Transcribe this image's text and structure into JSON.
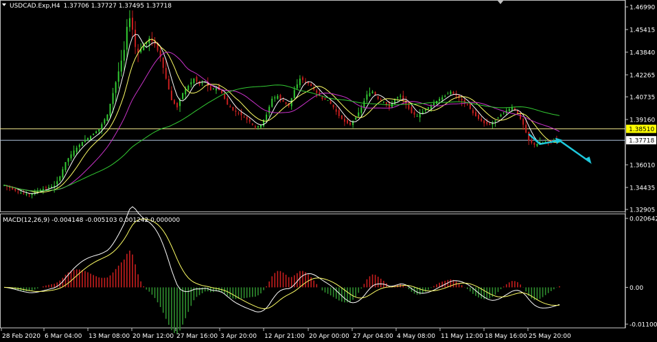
{
  "chart_data": [
    {
      "type": "candlestick",
      "symbol_label": "USDCAD.Exp,H4",
      "ohlc_label": "1.37706 1.37727 1.37495 1.37718",
      "ylim": [
        1.32905,
        1.4699
      ],
      "y_ticks": [
        "1.46990",
        "1.45415",
        "1.43840",
        "1.42265",
        "1.40735",
        "1.39160",
        "1.36010",
        "1.34435",
        "1.32905"
      ],
      "levels": [
        {
          "name": "resistance",
          "value": 1.3851,
          "label": "1.38510",
          "color": "#f0e68c",
          "tag_bg": "#ffff00",
          "tag_fg": "#000000"
        },
        {
          "name": "bid",
          "value": 1.37718,
          "label": "1.37718",
          "color": "#b0c4de",
          "tag_bg": "#ffffff",
          "tag_fg": "#000000"
        }
      ],
      "x_labels": [
        "28 Feb 2020",
        "6 Mar 04:00",
        "13 Mar 08:00",
        "20 Mar 12:00",
        "27 Mar 16:00",
        "3 Apr 20:00",
        "12 Apr 21:00",
        "20 Apr 00:00",
        "27 Apr 04:00",
        "4 May 08:00",
        "11 May 12:00",
        "18 May 16:00",
        "25 May 20:00"
      ],
      "close_path": [
        [
          0,
          1.346
        ],
        [
          3,
          1.343
        ],
        [
          6,
          1.3405
        ],
        [
          9,
          1.3395
        ],
        [
          12,
          1.342
        ],
        [
          15,
          1.344
        ],
        [
          18,
          1.3455
        ],
        [
          20,
          1.352
        ],
        [
          22,
          1.362
        ],
        [
          25,
          1.37
        ],
        [
          28,
          1.376
        ],
        [
          31,
          1.38
        ],
        [
          34,
          1.385
        ],
        [
          37,
          1.395
        ],
        [
          39,
          1.41
        ],
        [
          41,
          1.425
        ],
        [
          43,
          1.44
        ],
        [
          44,
          1.456
        ],
        [
          45,
          1.462
        ],
        [
          46,
          1.454
        ],
        [
          47,
          1.442
        ],
        [
          48,
          1.438
        ],
        [
          50,
          1.443
        ],
        [
          52,
          1.448
        ],
        [
          54,
          1.444
        ],
        [
          56,
          1.435
        ],
        [
          58,
          1.42
        ],
        [
          60,
          1.405
        ],
        [
          62,
          1.4
        ],
        [
          64,
          1.41
        ],
        [
          66,
          1.415
        ],
        [
          68,
          1.42
        ],
        [
          70,
          1.416
        ],
        [
          72,
          1.418
        ],
        [
          74,
          1.412
        ],
        [
          76,
          1.414
        ],
        [
          78,
          1.41
        ],
        [
          80,
          1.402
        ],
        [
          82,
          1.398
        ],
        [
          84,
          1.396
        ],
        [
          86,
          1.393
        ],
        [
          88,
          1.39
        ],
        [
          90,
          1.386
        ],
        [
          92,
          1.388
        ],
        [
          94,
          1.395
        ],
        [
          96,
          1.406
        ],
        [
          98,
          1.408
        ],
        [
          100,
          1.404
        ],
        [
          102,
          1.401
        ],
        [
          104,
          1.412
        ],
        [
          106,
          1.42
        ],
        [
          108,
          1.418
        ],
        [
          110,
          1.415
        ],
        [
          112,
          1.41
        ],
        [
          114,
          1.406
        ],
        [
          116,
          1.405
        ],
        [
          118,
          1.4
        ],
        [
          120,
          1.394
        ],
        [
          122,
          1.39
        ],
        [
          124,
          1.388
        ],
        [
          126,
          1.393
        ],
        [
          128,
          1.4
        ],
        [
          130,
          1.409
        ],
        [
          132,
          1.411
        ],
        [
          134,
          1.406
        ],
        [
          136,
          1.404
        ],
        [
          138,
          1.4
        ],
        [
          140,
          1.406
        ],
        [
          142,
          1.408
        ],
        [
          144,
          1.402
        ],
        [
          146,
          1.396
        ],
        [
          148,
          1.394
        ],
        [
          150,
          1.397
        ],
        [
          152,
          1.4
        ],
        [
          154,
          1.403
        ],
        [
          156,
          1.406
        ],
        [
          158,
          1.408
        ],
        [
          160,
          1.411
        ],
        [
          162,
          1.408
        ],
        [
          164,
          1.405
        ],
        [
          166,
          1.402
        ],
        [
          168,
          1.396
        ],
        [
          170,
          1.392
        ],
        [
          172,
          1.389
        ],
        [
          174,
          1.388
        ],
        [
          176,
          1.391
        ],
        [
          178,
          1.395
        ],
        [
          180,
          1.398
        ],
        [
          182,
          1.4
        ],
        [
          184,
          1.396
        ],
        [
          186,
          1.388
        ],
        [
          188,
          1.377
        ],
        [
          190,
          1.374
        ],
        [
          192,
          1.375
        ],
        [
          194,
          1.376
        ],
        [
          196,
          1.3765
        ],
        [
          198,
          1.3772
        ]
      ],
      "bars_total": 200,
      "moving_averages": [
        {
          "name": "fast",
          "color": "#ffffff",
          "period": 5
        },
        {
          "name": "medium",
          "color": "#ffff66",
          "period": 10
        },
        {
          "name": "slow",
          "color": "#cc33cc",
          "period": 20
        },
        {
          "name": "trend",
          "color": "#33cc33",
          "period": 60
        }
      ],
      "forecast_arrow": {
        "color": "#1ec8dc",
        "points": [
          [
            188,
            1.3815
          ],
          [
            192,
            1.3745
          ],
          [
            199,
            1.377
          ],
          [
            204,
            1.372
          ],
          [
            210,
            1.362
          ]
        ]
      }
    },
    {
      "type": "macd",
      "label": "MACD(12,26,9) -0.004148 -0.005103 0.001242 0.000000",
      "ylim": [
        -0.011007,
        0.020642
      ],
      "y_ticks": [
        "0.020642",
        "0.00",
        "-0.011007"
      ],
      "hist_up_color": "#c81e1e",
      "hist_down_color": "#2f8f2f",
      "macd_color": "#ffffff",
      "signal_color": "#ffff66"
    }
  ]
}
